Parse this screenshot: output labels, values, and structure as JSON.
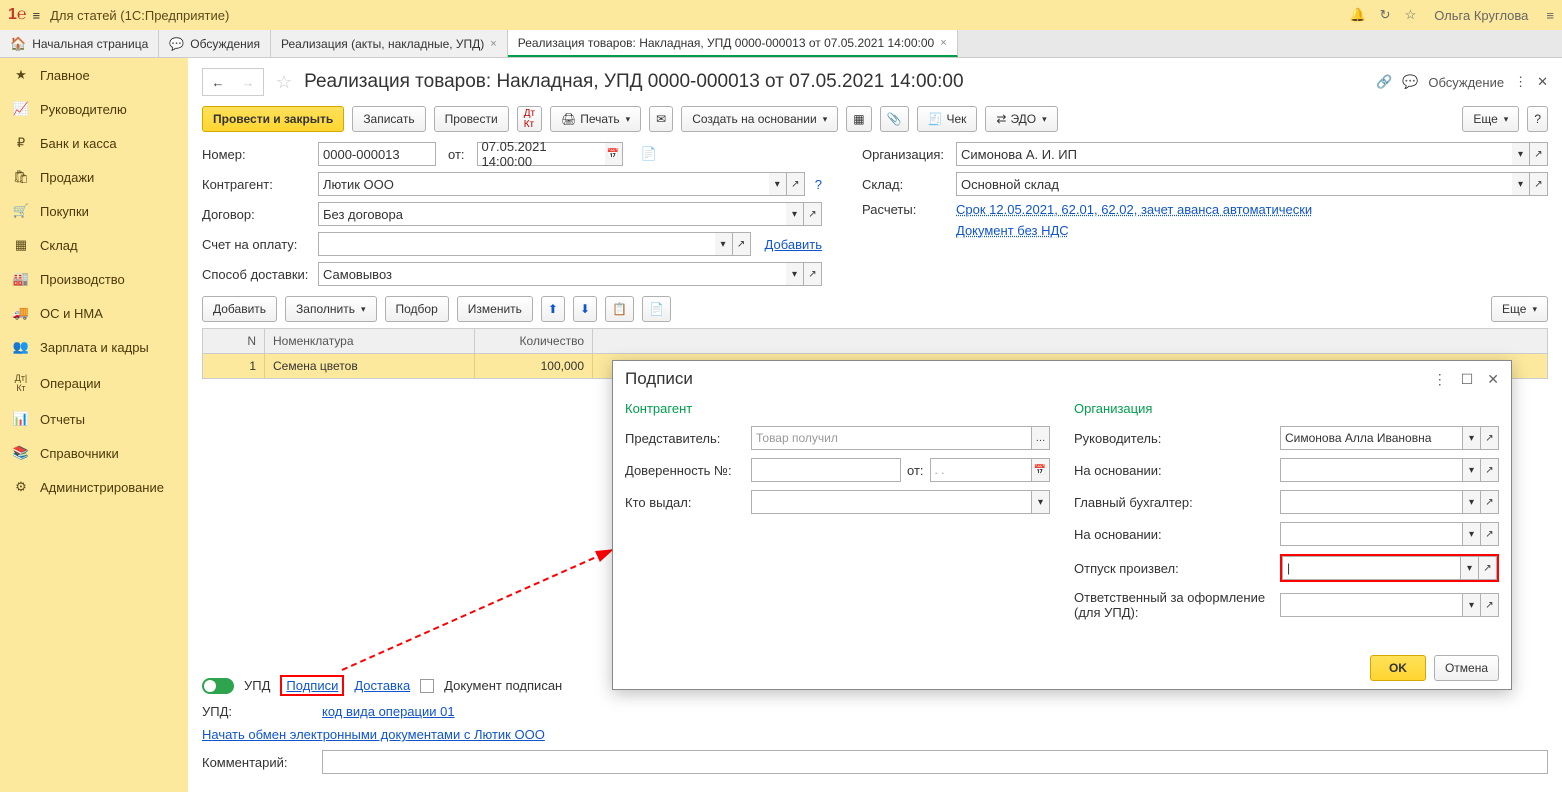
{
  "titlebar": {
    "app": "Для статей  (1С:Предприятие)",
    "user": "Ольга Круглова"
  },
  "tabs": [
    {
      "label": "Начальная страница",
      "icon": "🏠"
    },
    {
      "label": "Обсуждения",
      "icon": "💬"
    },
    {
      "label": "Реализация (акты, накладные, УПД)",
      "close": "×"
    },
    {
      "label": "Реализация товаров: Накладная, УПД 0000-000013 от 07.05.2021 14:00:00",
      "close": "×",
      "active": true
    }
  ],
  "sidebar": [
    "Главное",
    "Руководителю",
    "Банк и касса",
    "Продажи",
    "Покупки",
    "Склад",
    "Производство",
    "ОС и НМА",
    "Зарплата и кадры",
    "Операции",
    "Отчеты",
    "Справочники",
    "Администрирование"
  ],
  "sidebar_icons": [
    "★",
    "📈",
    "₽",
    "🛍",
    "🛒",
    "▦",
    "🏭",
    "🚚",
    "👥",
    "Дт|Кт",
    "📊",
    "📚",
    "⚙"
  ],
  "doc": {
    "title": "Реализация товаров: Накладная, УПД 0000-000013 от 07.05.2021 14:00:00",
    "discuss": "Обсуждение"
  },
  "toolbar": {
    "post_close": "Провести и закрыть",
    "write": "Записать",
    "post": "Провести",
    "print": "Печать",
    "create_based": "Создать на основании",
    "check": "Чек",
    "edo": "ЭДО",
    "more": "Еще"
  },
  "fields": {
    "number_l": "Номер:",
    "number_v": "0000-000013",
    "from_l": "от:",
    "date_v": "07.05.2021 14:00:00",
    "org_l": "Организация:",
    "org_v": "Симонова А. И. ИП",
    "ka_l": "Контрагент:",
    "ka_v": "Лютик ООО",
    "store_l": "Склад:",
    "store_v": "Основной склад",
    "dog_l": "Договор:",
    "dog_v": "Без договора",
    "calc_l": "Расчеты:",
    "calc_link": "Срок 12.05.2021, 62.01, 62.02, зачет аванса автоматически",
    "bill_l": "Счет на оплату:",
    "add_link": "Добавить",
    "nds_link": "Документ без НДС",
    "deliv_l": "Способ доставки:",
    "deliv_v": "Самовывоз"
  },
  "tbl_toolbar": {
    "add": "Добавить",
    "fill": "Заполнить",
    "pick": "Подбор",
    "change": "Изменить",
    "more": "Еще"
  },
  "table": {
    "headers": {
      "n": "N",
      "nom": "Номенклатура",
      "qty": "Количество"
    },
    "rows": [
      {
        "n": "1",
        "nom": "Семена цветов",
        "qty": "100,000"
      }
    ]
  },
  "footer": {
    "upd": "УПД",
    "sign": "Подписи",
    "delivery": "Доставка",
    "signed": "Документ подписан",
    "upd_l": "УПД:",
    "upd_link": "код вида операции 01",
    "exchange": "Начать обмен электронными документами с Лютик ООО",
    "comment_l": "Комментарий:"
  },
  "dialog": {
    "title": "Подписи",
    "sec1": "Контрагент",
    "sec2": "Организация",
    "rep_l": "Представитель:",
    "rep_ph": "Товар получил",
    "dov_l": "Доверенность №:",
    "dov_from": "от:",
    "dov_date": ".  .",
    "who_l": "Кто выдал:",
    "ruk_l": "Руководитель:",
    "ruk_v": "Симонова Алла Ивановна",
    "osn1_l": "На основании:",
    "gb_l": "Главный бухгалтер:",
    "osn2_l": "На основании:",
    "otp_l": "Отпуск произвел:",
    "resp_l": "Ответственный за оформление (для УПД):",
    "ok": "OK",
    "cancel": "Отмена"
  }
}
